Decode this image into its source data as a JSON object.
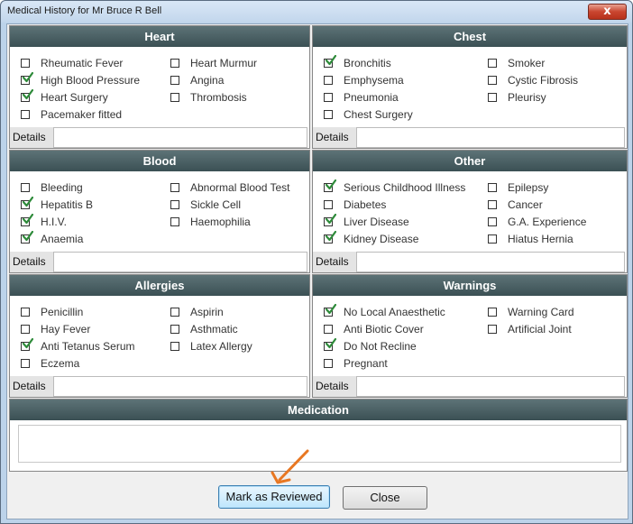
{
  "window": {
    "title": "Medical History for Mr Bruce R Bell",
    "close_glyph": "x"
  },
  "sections": {
    "heart": {
      "title": "Heart",
      "details_label": "Details",
      "items": [
        {
          "label": "Rheumatic Fever",
          "checked": false
        },
        {
          "label": "High Blood Pressure",
          "checked": true
        },
        {
          "label": "Heart Surgery",
          "checked": true
        },
        {
          "label": "Pacemaker fitted",
          "checked": false
        },
        {
          "label": "Heart Murmur",
          "checked": false
        },
        {
          "label": "Angina",
          "checked": false
        },
        {
          "label": "Thrombosis",
          "checked": false
        }
      ]
    },
    "chest": {
      "title": "Chest",
      "details_label": "Details",
      "items": [
        {
          "label": "Bronchitis",
          "checked": true
        },
        {
          "label": "Emphysema",
          "checked": false
        },
        {
          "label": "Pneumonia",
          "checked": false
        },
        {
          "label": "Chest Surgery",
          "checked": false
        },
        {
          "label": "Smoker",
          "checked": false
        },
        {
          "label": "Cystic Fibrosis",
          "checked": false
        },
        {
          "label": "Pleurisy",
          "checked": false
        }
      ]
    },
    "blood": {
      "title": "Blood",
      "details_label": "Details",
      "items": [
        {
          "label": "Bleeding",
          "checked": false
        },
        {
          "label": "Hepatitis B",
          "checked": true
        },
        {
          "label": "H.I.V.",
          "checked": true
        },
        {
          "label": "Anaemia",
          "checked": true
        },
        {
          "label": "Abnormal Blood Test",
          "checked": false
        },
        {
          "label": "Sickle Cell",
          "checked": false
        },
        {
          "label": "Haemophilia",
          "checked": false
        }
      ]
    },
    "other": {
      "title": "Other",
      "details_label": "Details",
      "items": [
        {
          "label": "Serious Childhood Illness",
          "checked": true
        },
        {
          "label": "Diabetes",
          "checked": false
        },
        {
          "label": "Liver Disease",
          "checked": true
        },
        {
          "label": "Kidney Disease",
          "checked": true
        },
        {
          "label": "Epilepsy",
          "checked": false
        },
        {
          "label": "Cancer",
          "checked": false
        },
        {
          "label": "G.A. Experience",
          "checked": false
        },
        {
          "label": "Hiatus Hernia",
          "checked": false
        }
      ]
    },
    "allergies": {
      "title": "Allergies",
      "details_label": "Details",
      "items": [
        {
          "label": "Penicillin",
          "checked": false
        },
        {
          "label": "Hay Fever",
          "checked": false
        },
        {
          "label": "Anti Tetanus Serum",
          "checked": true
        },
        {
          "label": "Eczema",
          "checked": false
        },
        {
          "label": "Aspirin",
          "checked": false
        },
        {
          "label": "Asthmatic",
          "checked": false
        },
        {
          "label": "Latex Allergy",
          "checked": false
        }
      ]
    },
    "warnings": {
      "title": "Warnings",
      "details_label": "Details",
      "items": [
        {
          "label": "No Local Anaesthetic",
          "checked": true
        },
        {
          "label": "Anti Biotic Cover",
          "checked": false
        },
        {
          "label": "Do Not Recline",
          "checked": true
        },
        {
          "label": "Pregnant",
          "checked": false
        },
        {
          "label": "Warning Card",
          "checked": false
        },
        {
          "label": "Artificial Joint",
          "checked": false
        }
      ]
    }
  },
  "medication": {
    "title": "Medication",
    "value": ""
  },
  "buttons": {
    "mark_reviewed": "Mark as Reviewed",
    "close": "Close"
  },
  "colors": {
    "header_bg": "#4a6064",
    "check_green": "#2e8b3a",
    "annotation_arrow": "#e87722"
  }
}
